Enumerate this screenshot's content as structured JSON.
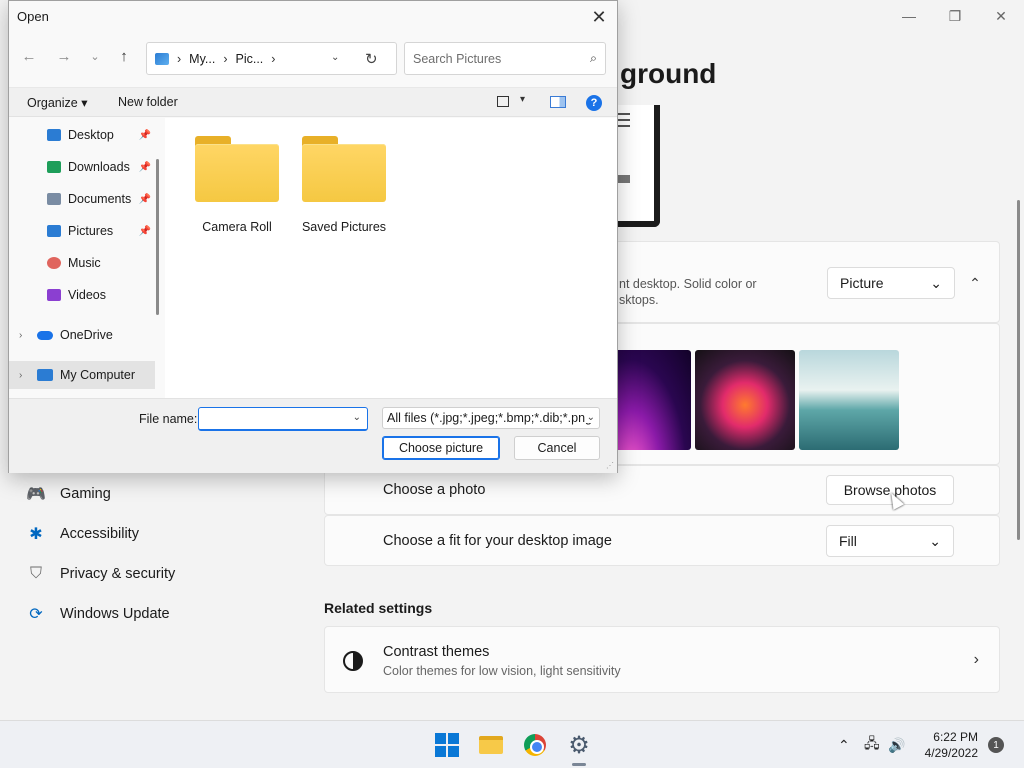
{
  "settings": {
    "page_title_fragment": "ground",
    "window_controls": [
      "—",
      "❐",
      "✕"
    ],
    "background_card": {
      "desc_line1": "nt desktop. Solid color or",
      "desc_line2": "sktops.",
      "dropdown_value": "Picture",
      "collapse_glyph": "⌃"
    },
    "choose_photo_label": "Choose a photo",
    "browse_button": "Browse photos",
    "fit_label": "Choose a fit for your desktop image",
    "fit_value": "Fill",
    "related_heading": "Related settings",
    "contrast_title": "Contrast themes",
    "contrast_subtitle": "Color themes for low vision, light sensitivity",
    "chevron": "›"
  },
  "nav": [
    {
      "label": "Gaming",
      "icon": "gamepad-icon",
      "glyph": "🎮"
    },
    {
      "label": "Accessibility",
      "icon": "accessibility-icon",
      "glyph": "✱"
    },
    {
      "label": "Privacy & security",
      "icon": "shield-icon",
      "glyph": "⛉"
    },
    {
      "label": "Windows Update",
      "icon": "update-icon",
      "glyph": "⟳"
    }
  ],
  "taskbar": {
    "time": "6:22 PM",
    "date": "4/29/2022",
    "notifications": "1",
    "tray_glyphs": {
      "chevron_up": "⌃",
      "network": "🖧",
      "volume": "🔊"
    }
  },
  "dialog": {
    "title": "Open",
    "close_glyph": "✕",
    "nav_glyphs": {
      "back": "←",
      "forward": "→",
      "recent": "⌄",
      "up": "↑"
    },
    "breadcrumb": [
      "My...",
      "Pic..."
    ],
    "search_placeholder": "Search Pictures",
    "toolbar": {
      "organize": "Organize ▾",
      "new_folder": "New folder"
    },
    "sidebar": [
      {
        "label": "Desktop",
        "color": "#2b7cd3",
        "pinned": true
      },
      {
        "label": "Downloads",
        "color": "#1e9e5a",
        "pinned": true
      },
      {
        "label": "Documents",
        "color": "#7a8ca3",
        "pinned": true
      },
      {
        "label": "Pictures",
        "color": "#2b7cd3",
        "pinned": true
      },
      {
        "label": "Music",
        "color": "#e0655e",
        "pinned": false
      },
      {
        "label": "Videos",
        "color": "#8b3fd1",
        "pinned": false
      },
      {
        "label": "OneDrive",
        "color": "#1a73e8",
        "pinned": false
      },
      {
        "label": "My Computer",
        "color": "#2b7cd3",
        "pinned": false
      }
    ],
    "folders": [
      "Camera Roll",
      "Saved Pictures"
    ],
    "file_name_label": "File name:",
    "file_name_value": "",
    "filter_value": "All files (*.jpg;*.jpeg;*.bmp;*.dib;*.png",
    "choose_button": "Choose picture",
    "cancel_button": "Cancel"
  }
}
